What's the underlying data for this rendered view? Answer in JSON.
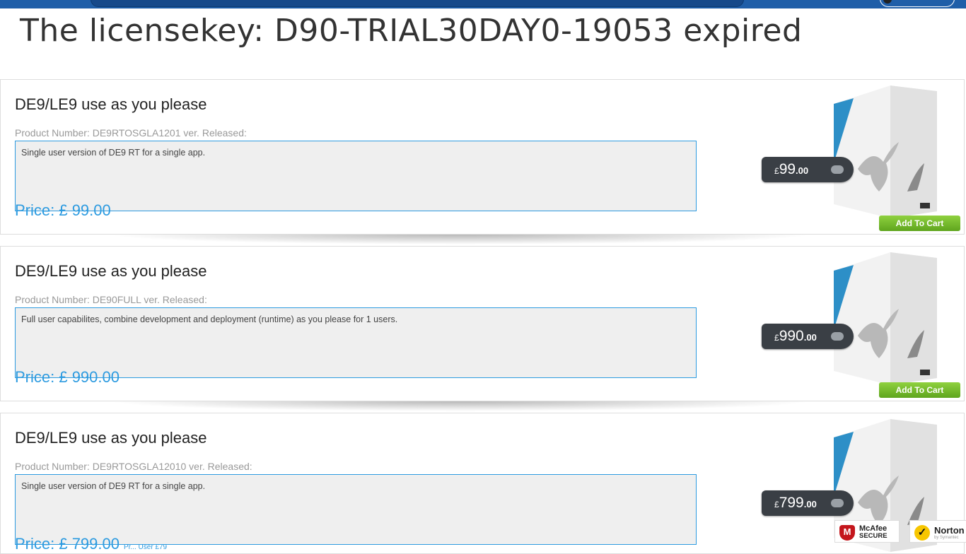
{
  "header": {
    "title": "The licensekey: D90-TRIAL30DAY0-19053 expired"
  },
  "products": [
    {
      "title": "DE9/LE9 use as you please",
      "product_number": "Product Number: DE9RTOSGLA1201 ver. Released:",
      "description": "Single user version of DE9 RT for a single app.",
      "price": "Price: £ 99.00",
      "price_note": "",
      "tag_currency": "£",
      "tag_whole": "99",
      "tag_decimal": ".00",
      "button": "Add To Cart"
    },
    {
      "title": "DE9/LE9 use as you please",
      "product_number": "Product Number: DE90FULL ver. Released:",
      "description": "Full user capabilites, combine development and deployment (runtime) as you please for 1 users.",
      "price": "Price: £ 990.00",
      "price_note": "",
      "tag_currency": "£",
      "tag_whole": "990",
      "tag_decimal": ".00",
      "button": "Add To Cart"
    },
    {
      "title": "DE9/LE9 use as you please",
      "product_number": "Product Number: DE9RTOSGLA12010 ver. Released:",
      "description": "Single user version of DE9 RT for a single app.",
      "price": "Price: £ 799.00",
      "price_note": "Pr... User £79",
      "tag_currency": "£",
      "tag_whole": "799",
      "tag_decimal": ".00",
      "button": ""
    }
  ],
  "badges": {
    "mcafee_line1": "McAfee",
    "mcafee_line2": "SECURE",
    "norton_line1": "Norton",
    "norton_line2": "by Symantec"
  },
  "colors": {
    "accent": "#2d9be0",
    "topbar": "#1f5ea8",
    "cart_green": "#6cb52a",
    "tag_dark": "#3a3f45"
  }
}
